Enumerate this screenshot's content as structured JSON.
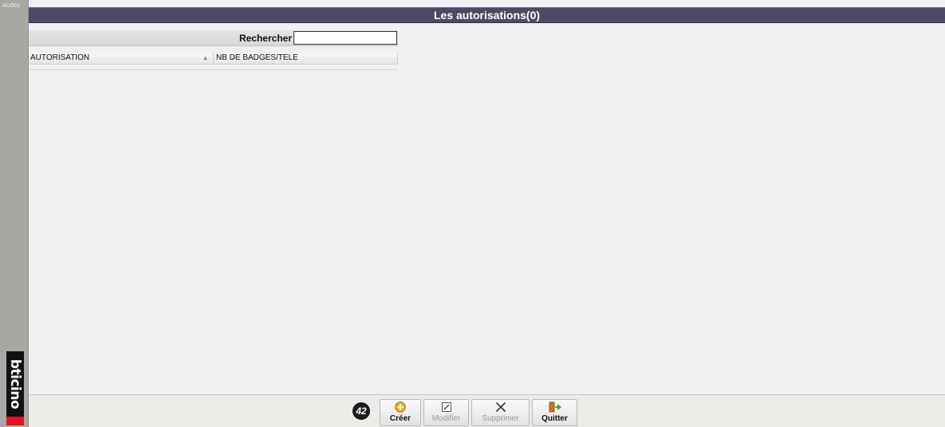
{
  "screen_code": "AU001",
  "brand": {
    "logo_text": "bticino"
  },
  "title": "Les autorisations(0)",
  "search": {
    "label": "Rechercher",
    "value": ""
  },
  "table": {
    "columns": [
      {
        "label": "AUTORISATION",
        "sort": "ascending"
      },
      {
        "label": "NB DE BADGES/TELE"
      }
    ],
    "rows": []
  },
  "toolbar": {
    "step_badge": "42",
    "buttons": [
      {
        "label": "Créer",
        "icon": "plus-circle-icon",
        "enabled": true
      },
      {
        "label": "Modifier",
        "icon": "edit-icon",
        "enabled": false
      },
      {
        "label": "Supprimer",
        "icon": "delete-x-icon",
        "enabled": false
      },
      {
        "label": "Quitter",
        "icon": "exit-door-icon",
        "enabled": true
      }
    ]
  },
  "colors": {
    "title_bar": "#4c4a64",
    "side_strip": "#a8a7a2",
    "logo_red": "#e3141c"
  }
}
